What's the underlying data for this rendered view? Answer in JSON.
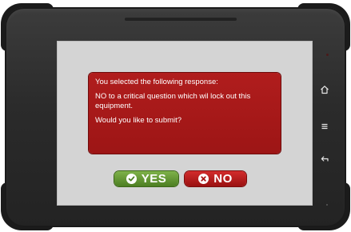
{
  "dialog": {
    "line1": "You selected the following response:",
    "line2": "NO to a critical question which wil lock out this equipment.",
    "line3": "Would you like to submit?"
  },
  "buttons": {
    "yes": {
      "label": "YES",
      "icon": "check-circle-icon",
      "color": "#5a8c2e"
    },
    "no": {
      "label": "NO",
      "icon": "x-circle-icon",
      "color": "#b81c1c"
    }
  },
  "hardware_keys": [
    {
      "icon": "home-icon"
    },
    {
      "icon": "menu-icon"
    },
    {
      "icon": "back-icon"
    }
  ],
  "colors": {
    "dialog_bg": "#a81a1a",
    "screen_bg": "#d4d4d4",
    "bezel": "#2e2e2e"
  }
}
